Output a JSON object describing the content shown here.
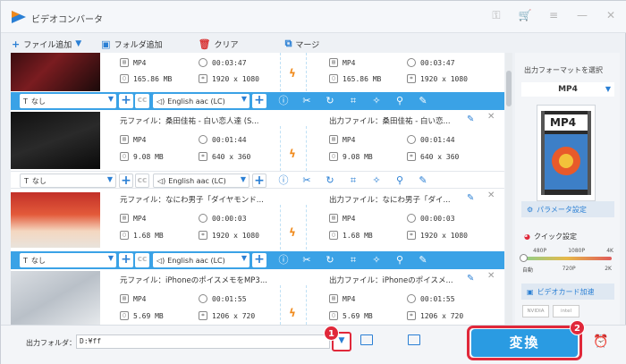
{
  "app": {
    "title": "ビデオコンバータ"
  },
  "toolbar": {
    "add_file": "ファイル追加",
    "add_folder": "フォルダ追加",
    "clear": "クリア",
    "merge": "マージ"
  },
  "common": {
    "source_prefix": "元ファイル：",
    "output_prefix": "出力ファイル："
  },
  "items": [
    {
      "source": {
        "format": "MP4",
        "duration": "00:03:47",
        "size": "165.86 MB",
        "resolution": "1920 x 1080"
      },
      "output": {
        "format": "MP4",
        "duration": "00:03:47",
        "size": "165.86 MB",
        "resolution": "1920 x 1080"
      },
      "subtitle": "なし",
      "audio": "English aac (LC)"
    },
    {
      "source_title": "桑田佳祐 - 白い恋人達 (S...",
      "output_title": "桑田佳祐 - 白い恋...",
      "source": {
        "format": "MP4",
        "duration": "00:01:44",
        "size": "9.08 MB",
        "resolution": "640 x 360"
      },
      "output": {
        "format": "MP4",
        "duration": "00:01:44",
        "size": "9.08 MB",
        "resolution": "640 x 360"
      },
      "subtitle": "なし",
      "audio": "English aac (LC)"
    },
    {
      "source_title": "なにわ男子「ダイヤモンド...",
      "output_title": "なにわ男子「ダイ...",
      "source": {
        "format": "MP4",
        "duration": "00:00:03",
        "size": "1.68 MB",
        "resolution": "1920 x 1080"
      },
      "output": {
        "format": "MP4",
        "duration": "00:00:03",
        "size": "1.68 MB",
        "resolution": "1920 x 1080"
      },
      "subtitle": "なし",
      "audio": "English aac (LC)"
    },
    {
      "source_title": "iPhoneのポイスメモをMP3...",
      "output_title": "iPhoneのポイスメ...",
      "source": {
        "format": "MP4",
        "duration": "00:01:55",
        "size": "5.69 MB",
        "resolution": "1206 x 720"
      },
      "output": {
        "format": "MP4",
        "duration": "00:01:55",
        "size": "5.69 MB",
        "resolution": "1206 x 720"
      }
    }
  ],
  "right_panel": {
    "title": "出力フォーマットを選択",
    "format": "MP4",
    "format_image_text": "MP4",
    "param_button": "パラメータ設定",
    "quick_setting": "クイック設定",
    "quality_top": [
      "480P",
      "1080P",
      "4K"
    ],
    "quality_bottom": [
      "自動",
      "720P",
      "2K"
    ],
    "gpu_button": "ビデオカード加速",
    "gpu_vendors": [
      "NVIDIA",
      "intel"
    ]
  },
  "bottom": {
    "output_folder_label": "出力フォルダ：",
    "output_path": "D:¥ff",
    "convert_button": "変換",
    "badge1": "1",
    "badge2": "2"
  },
  "colors": {
    "accent": "#2a9be2",
    "highlight": "#e0283a",
    "editbar": "#3aa2e6"
  }
}
